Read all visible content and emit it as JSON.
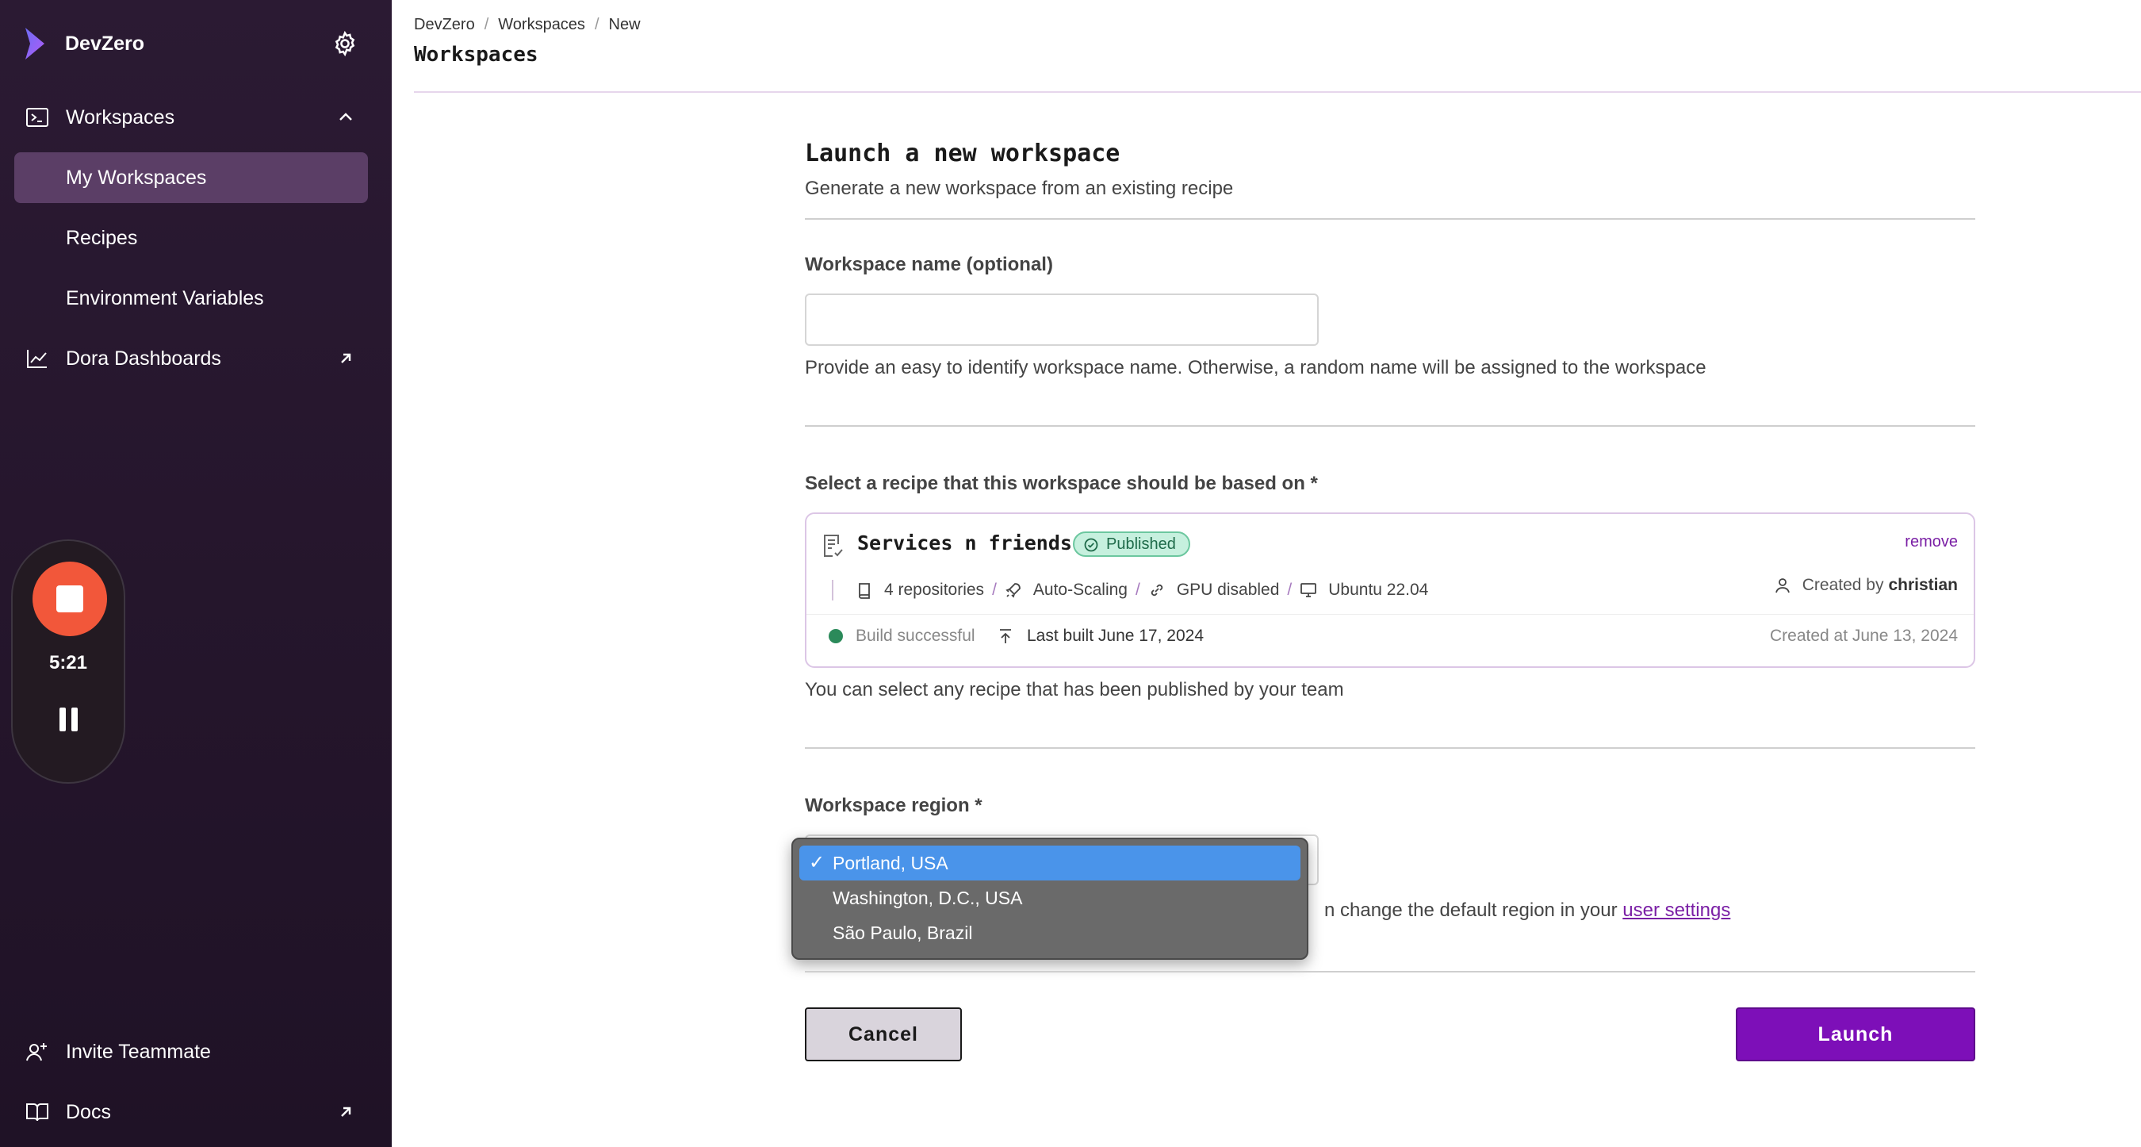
{
  "app": {
    "name": "DevZero"
  },
  "sidebar": {
    "items": [
      {
        "label": "Workspaces",
        "icon": "terminal-icon"
      },
      {
        "label": "My Workspaces"
      },
      {
        "label": "Recipes"
      },
      {
        "label": "Environment Variables"
      },
      {
        "label": "Dora Dashboards",
        "icon": "chart-line-icon"
      }
    ],
    "bottom": [
      {
        "label": "Invite Teammate",
        "icon": "user-plus-icon"
      },
      {
        "label": "Docs",
        "icon": "book-icon"
      }
    ],
    "recorder": {
      "time": "5:21"
    }
  },
  "header": {
    "breadcrumb": [
      "DevZero",
      "Workspaces",
      "New"
    ],
    "title": "Workspaces"
  },
  "form": {
    "title": "Launch a new workspace",
    "subtitle": "Generate a new workspace from an existing recipe",
    "name_label": "Workspace name (optional)",
    "name_value": "",
    "name_help": "Provide an easy to identify workspace name. Otherwise, a random name will be assigned to the workspace",
    "recipe_label": "Select a recipe that this workspace should be based on *",
    "recipe": {
      "name": "Services n friends",
      "status_badge": "Published",
      "remove_label": "remove",
      "repos": "4 repositories",
      "scaling": "Auto-Scaling",
      "gpu": "GPU disabled",
      "os": "Ubuntu 22.04",
      "created_by_prefix": "Created by",
      "created_by": "christian",
      "build_status": "Build successful",
      "last_built": "Last built June 17, 2024",
      "created_at": "Created at June 13, 2024"
    },
    "recipe_help": "You can select any recipe that has been published by your team",
    "region_label": "Workspace region *",
    "region_options": [
      "Portland, USA",
      "Washington, D.C., USA",
      "São Paulo, Brazil"
    ],
    "region_selected": "Portland, USA",
    "region_help_visible": "n change the default region in your ",
    "region_help_link": "user settings",
    "cancel_label": "Cancel",
    "launch_label": "Launch"
  },
  "colors": {
    "accent": "#7d0fb8",
    "sidebar_bg": "#2b1a33",
    "selected_option": "#4a94ea",
    "badge_bg": "#c6f0de"
  }
}
